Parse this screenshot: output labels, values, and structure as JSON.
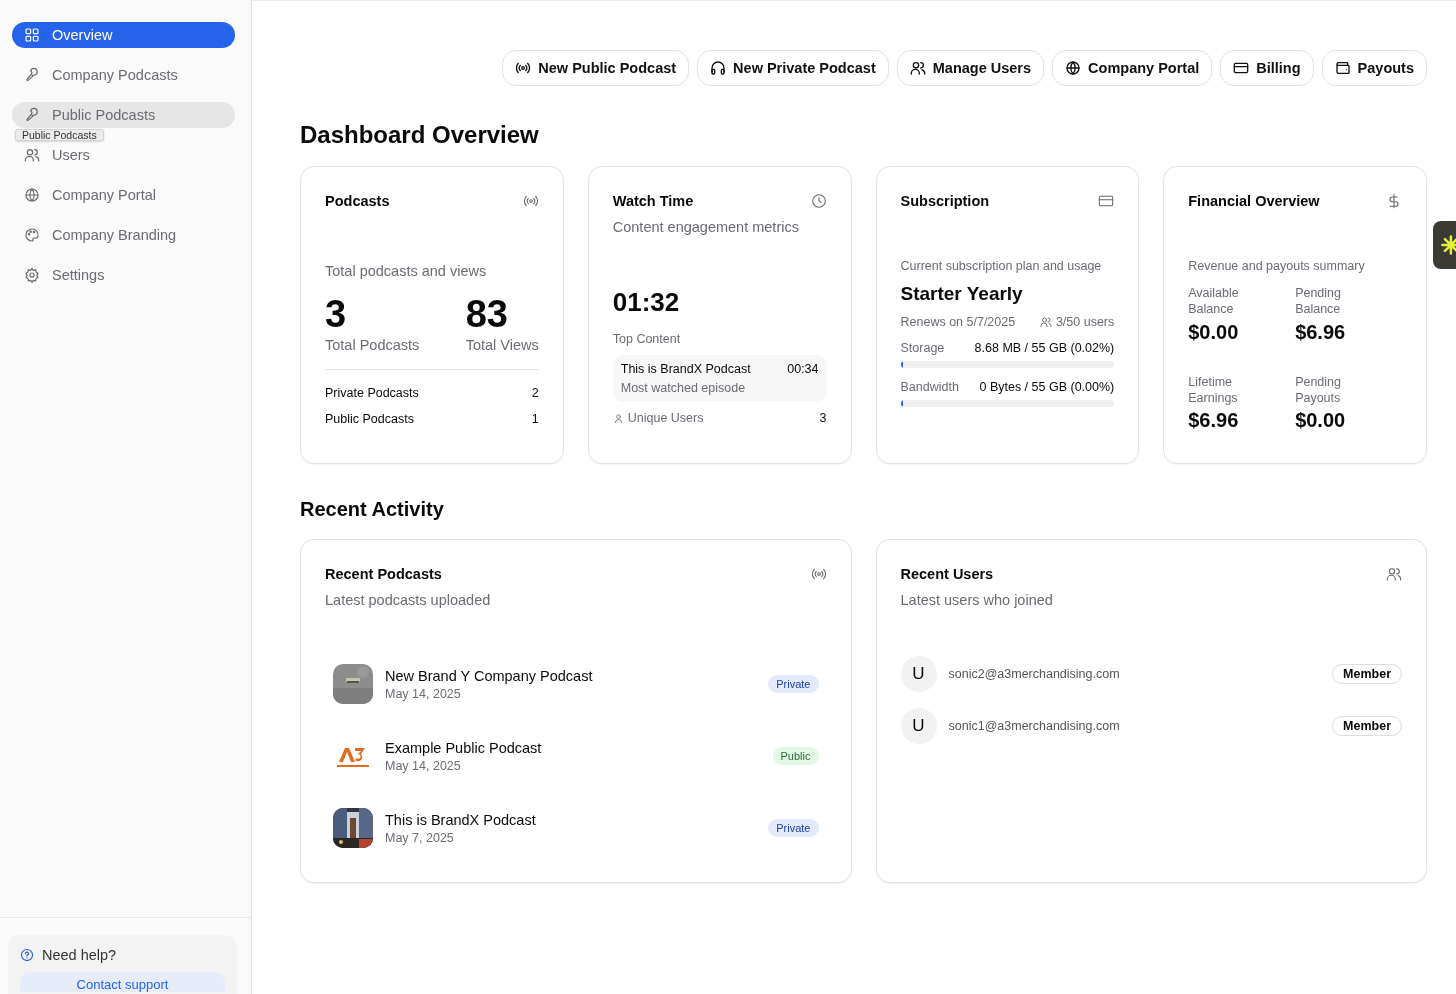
{
  "sidebar": {
    "items": [
      {
        "label": "Overview",
        "selected": true,
        "hovered": false
      },
      {
        "label": "Company Podcasts",
        "selected": false,
        "hovered": false
      },
      {
        "label": "Public Podcasts",
        "selected": false,
        "hovered": true,
        "tooltip": "Public Podcasts"
      },
      {
        "label": "Users",
        "selected": false,
        "hovered": false
      },
      {
        "label": "Company Portal",
        "selected": false,
        "hovered": false
      },
      {
        "label": "Company Branding",
        "selected": false,
        "hovered": false
      },
      {
        "label": "Settings",
        "selected": false,
        "hovered": false
      }
    ],
    "help": {
      "title": "Need help?",
      "button": "Contact support"
    }
  },
  "actions": [
    "New Public Podcast",
    "New Private Podcast",
    "Manage Users",
    "Company Portal",
    "Billing",
    "Payouts"
  ],
  "heading": "Dashboard Overview",
  "podcasts_card": {
    "title": "Podcasts",
    "subtitle": "Total podcasts and views",
    "stats": [
      {
        "value": "3",
        "label": "Total Podcasts"
      },
      {
        "value": "83",
        "label": "Total Views"
      }
    ],
    "rows": [
      {
        "label": "Private Podcasts",
        "value": "2"
      },
      {
        "label": "Public Podcasts",
        "value": "1"
      }
    ]
  },
  "watch_card": {
    "title": "Watch Time",
    "subtitle": "Content engagement metrics",
    "total": "01:32",
    "top_label": "Top Content",
    "top": {
      "title": "This is BrandX Podcast",
      "time": "00:34",
      "note": "Most watched episode"
    },
    "unique_label": "Unique Users",
    "unique_value": "3"
  },
  "subscription_card": {
    "title": "Subscription",
    "subtitle": "Current subscription plan and usage",
    "plan": "Starter Yearly",
    "renews": "Renews on 5/7/2025",
    "users": "3/50 users",
    "meters": [
      {
        "name": "Storage",
        "reading": "8.68 MB / 55 GB (0.02%)",
        "level": 0.0002
      },
      {
        "name": "Bandwidth",
        "reading": "0 Bytes / 55 GB (0.00%)",
        "level": 0
      }
    ]
  },
  "financial_card": {
    "title": "Financial Overview",
    "subtitle": "Revenue and payouts summary",
    "figures": [
      {
        "label": "Available Balance",
        "value": "$0.00"
      },
      {
        "label": "Pending Balance",
        "value": "$6.96"
      },
      {
        "label": "Lifetime Earnings",
        "value": "$6.96"
      },
      {
        "label": "Pending Payouts",
        "value": "$0.00"
      }
    ]
  },
  "activity_heading": "Recent Activity",
  "recent_podcasts": {
    "title": "Recent Podcasts",
    "subtitle": "Latest podcasts uploaded",
    "items": [
      {
        "title": "New Brand Y Company Podcast",
        "date": "May 14, 2025",
        "badge": "Private",
        "kind": "private"
      },
      {
        "title": "Example Public Podcast",
        "date": "May 14, 2025",
        "badge": "Public",
        "kind": "public"
      },
      {
        "title": "This is BrandX Podcast",
        "date": "May 7, 2025",
        "badge": "Private",
        "kind": "private"
      }
    ]
  },
  "recent_users": {
    "title": "Recent Users",
    "subtitle": "Latest users who joined",
    "items": [
      {
        "initial": "U",
        "email": "sonic2@a3merchandising.com",
        "role": "Member"
      },
      {
        "initial": "U",
        "email": "sonic1@a3merchandising.com",
        "role": "Member"
      }
    ]
  }
}
